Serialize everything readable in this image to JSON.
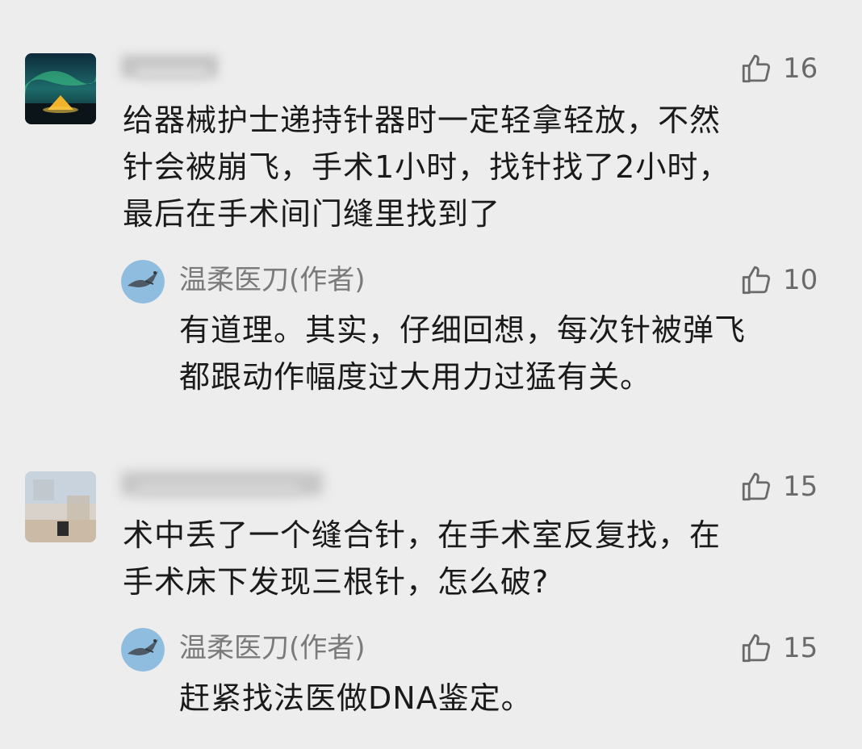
{
  "comments": [
    {
      "text": "给器械护士递持针器时一定轻拿轻放，不然\n针会被崩飞，手术1小时，找针找了2小时，\n最后在手术间门缝里找到了",
      "likes": "16",
      "reply": {
        "author": "温柔医刀(作者)",
        "likes": "10",
        "text": "有道理。其实，仔细回想，每次针被弹飞\n都跟动作幅度过大用力过猛有关。"
      }
    },
    {
      "text": "术中丢了一个缝合针，在手术室反复找，在\n手术床下发现三根针，怎么破?",
      "likes": "15",
      "reply": {
        "author": "温柔医刀(作者)",
        "likes": "15",
        "text": "赶紧找法医做DNA鉴定。"
      }
    }
  ],
  "icons": {
    "like": "thumbs-up-icon",
    "avatar_author": "bird-avatar-icon"
  },
  "colors": {
    "background": "#ededed",
    "text": "#1a1a1a",
    "muted": "#7a7a7a"
  }
}
